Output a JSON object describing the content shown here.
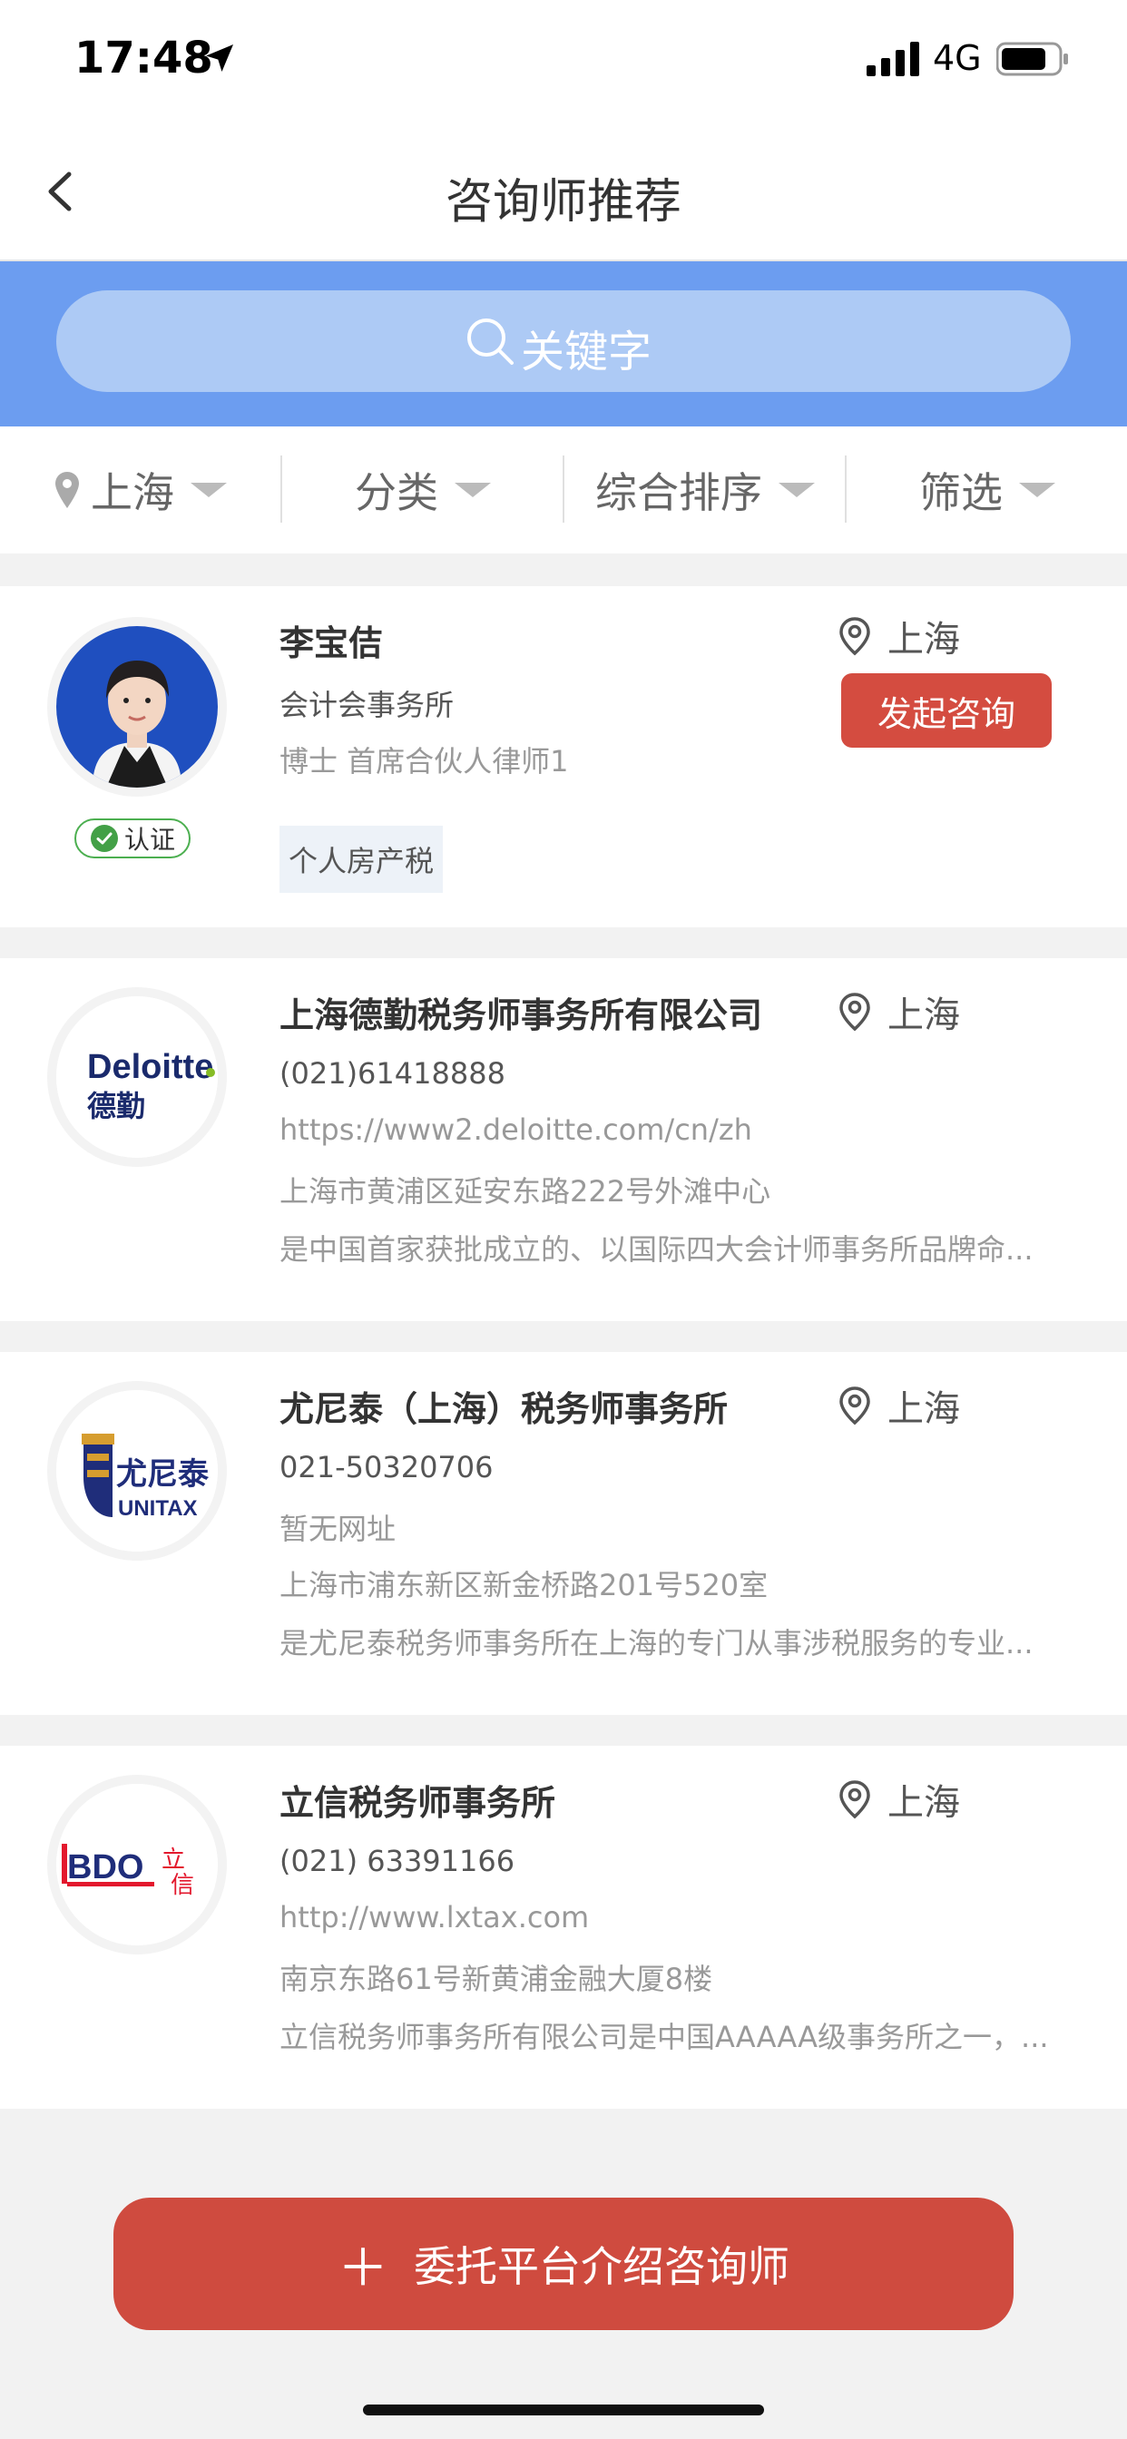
{
  "status_bar": {
    "time": "17:48",
    "network": "4G"
  },
  "nav": {
    "title": "咨询师推荐",
    "back_icon": "chevron-left-icon"
  },
  "search": {
    "placeholder": "关键字"
  },
  "filters": [
    {
      "label": "上海",
      "icon": "location-pin-icon"
    },
    {
      "label": "分类"
    },
    {
      "label": "综合排序"
    },
    {
      "label": "筛选"
    }
  ],
  "advisor": {
    "name": "李宝佶",
    "org": "会计会事务所",
    "title": "博士 首席合伙人律师1",
    "city": "上海",
    "consult_button": "发起咨询",
    "verified": "认证",
    "tag": "个人房产税"
  },
  "firms": [
    {
      "name": "上海德勤税务师事务所有限公司",
      "phone": "(021)61418888",
      "website": "https://www2.deloitte.com/cn/zh",
      "address": "上海市黄浦区延安东路222号外滩中心",
      "description": "是中国首家获批成立的、以国际四大会计师事务所品牌命...",
      "city": "上海",
      "logo": "Deloitte. 德勤"
    },
    {
      "name": "尤尼泰（上海）税务师事务所",
      "phone": "021-50320706",
      "website": "暂无网址",
      "address": "上海市浦东新区新金桥路201号520室",
      "description": "是尤尼泰税务师事务所在上海的专门从事涉税服务的专业...",
      "city": "上海",
      "logo": "尤尼泰 UNITAX"
    },
    {
      "name": "立信税务师事务所",
      "phone": "(021) 63391166",
      "website": "http://www.lxtax.com",
      "address": "南京东路61号新黄浦金融大厦8楼",
      "description": "立信税务师事务所有限公司是中国AAAAA级事务所之一，...",
      "city": "上海",
      "logo": "BDO 立信"
    }
  ],
  "bottom": {
    "entrust_button": "委托平台介绍咨询师",
    "plus_symbol": "＋"
  },
  "colors": {
    "accent_blue": "#6c9df0",
    "action_red": "#d44c40",
    "verified_green": "#4caf50"
  }
}
